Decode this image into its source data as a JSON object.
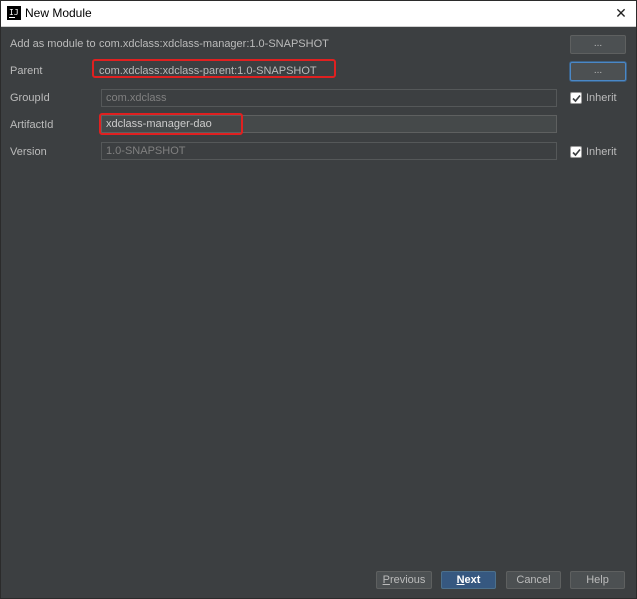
{
  "window": {
    "title": "New Module",
    "close_glyph": "✕",
    "app_icon_letters": "IJ"
  },
  "form": {
    "add_as_module": {
      "label": "Add as module to",
      "value": "com.xdclass:xdclass-manager:1.0-SNAPSHOT",
      "button_label": "..."
    },
    "parent": {
      "label": "Parent",
      "value": "com.xdclass:xdclass-parent:1.0-SNAPSHOT",
      "button_label": "..."
    },
    "group_id": {
      "label": "GroupId",
      "value": "com.xdclass",
      "inherit_label": "Inherit",
      "inherit_checked": true
    },
    "artifact_id": {
      "label": "ArtifactId",
      "value": "xdclass-manager-dao"
    },
    "version": {
      "label": "Version",
      "value": "1.0-SNAPSHOT",
      "inherit_label": "Inherit",
      "inherit_checked": true
    }
  },
  "footer": {
    "previous_label": "Previous",
    "next_label": "Next",
    "cancel_label": "Cancel",
    "help_label": "Help"
  },
  "colors": {
    "background": "#3c3f41",
    "highlight": "#e02020",
    "primary_button": "#365880"
  },
  "icons": {
    "close": "close-icon",
    "app": "intellij-icon",
    "check": "check-icon"
  }
}
